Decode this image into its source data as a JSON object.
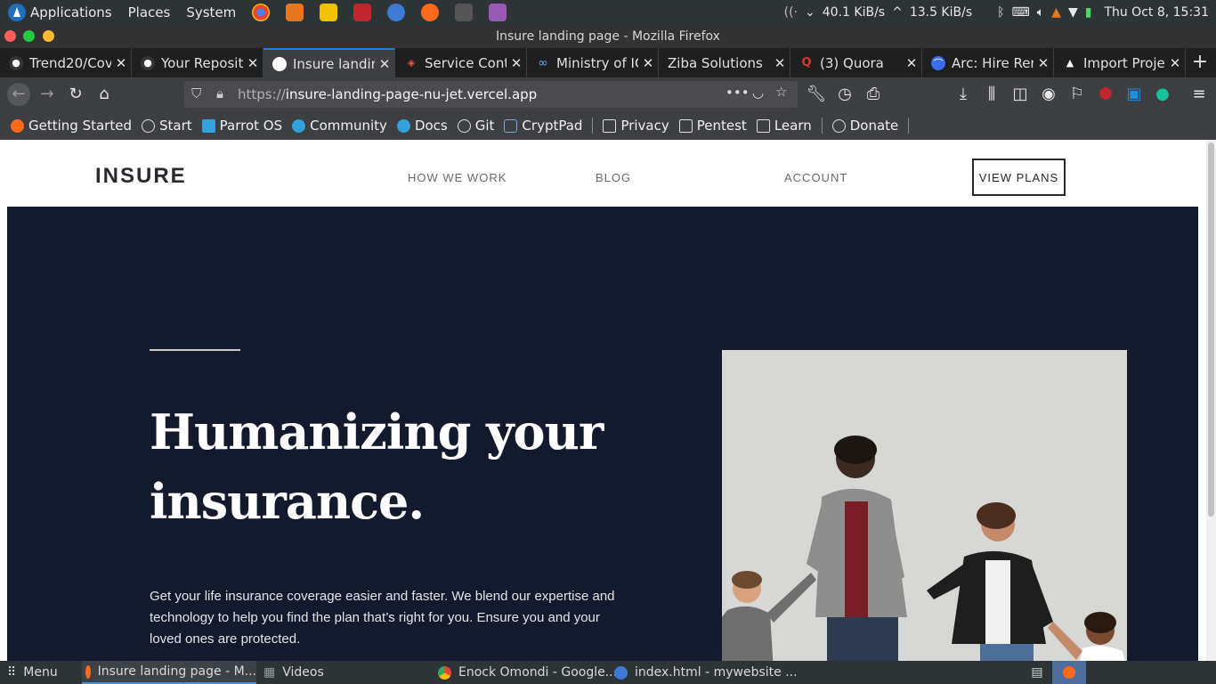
{
  "system_panel": {
    "menus": [
      "Applications",
      "Places",
      "System"
    ],
    "net_down": "40.1 KiB/s",
    "net_up": "13.5 KiB/s",
    "clock": "Thu Oct  8, 15:31"
  },
  "window": {
    "title": "Insure landing page - Mozilla Firefox"
  },
  "tabs": [
    {
      "label": "Trend20/Cov",
      "icon": "github-icon",
      "color": "#e0e0e0"
    },
    {
      "label": "Your Reposit",
      "icon": "github-icon",
      "color": "#e0e0e0"
    },
    {
      "label": "Insure landing",
      "icon": "globe-icon",
      "color": "#ffffff",
      "active": true
    },
    {
      "label": "Service Conta",
      "icon": "laravel-icon",
      "color": "#f05340"
    },
    {
      "label": "Ministry of IC",
      "icon": "infinity-icon",
      "color": "#5aa7ff"
    },
    {
      "label": "Ziba Solutions",
      "icon": "none",
      "color": "#e0e0e0"
    },
    {
      "label": "(3) Quora",
      "icon": "quora-icon",
      "color": "#b92b27"
    },
    {
      "label": "Arc: Hire Ren",
      "icon": "arc-icon",
      "color": "#3a6cf4"
    },
    {
      "label": "Import Proje",
      "icon": "triangle-icon",
      "color": "#ffffff"
    }
  ],
  "url": {
    "protocol": "https://",
    "host": "insure-landing-page-nu-jet.vercel.app"
  },
  "bookmarks": [
    {
      "label": "Getting Started",
      "icon": "firefox-icon"
    },
    {
      "label": "Start",
      "icon": "globe-icon"
    },
    {
      "label": "Parrot OS",
      "icon": "parrot-icon"
    },
    {
      "label": "Community",
      "icon": "parrot-icon"
    },
    {
      "label": "Docs",
      "icon": "parrot-icon"
    },
    {
      "label": "Git",
      "icon": "globe-icon"
    },
    {
      "label": "CryptPad",
      "icon": "cryptpad-icon"
    },
    {
      "label": "Privacy",
      "icon": "folder-icon"
    },
    {
      "label": "Pentest",
      "icon": "folder-icon"
    },
    {
      "label": "Learn",
      "icon": "folder-icon"
    },
    {
      "label": "Donate",
      "icon": "globe-icon"
    }
  ],
  "site": {
    "logo": "INSURE",
    "nav": [
      "HOW WE WORK",
      "BLOG",
      "ACCOUNT"
    ],
    "cta": "VIEW PLANS",
    "hero_title": "Humanizing your insurance.",
    "hero_text": "Get your life insurance coverage easier and faster. We blend our expertise and technology to help you find the plan that’s right for you. Ensure you and your loved ones are protected."
  },
  "taskbar": {
    "menu": "Menu",
    "tasks": [
      "Insure landing page - M...",
      "Videos",
      "Enock Omondi - Google...",
      "index.html - mywebsite ..."
    ]
  },
  "colors": {
    "hero_bg": "#141a2e",
    "tab_accent": "#0a84ff"
  }
}
